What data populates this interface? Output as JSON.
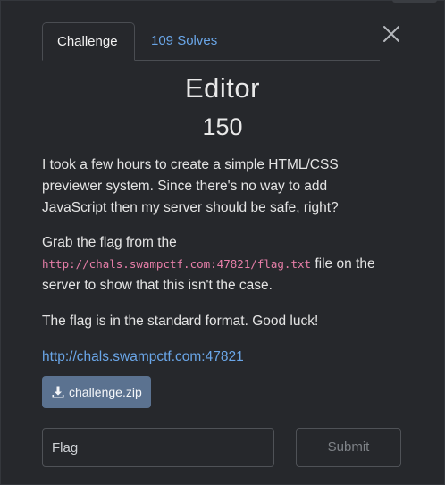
{
  "tabs": {
    "challenge": "Challenge",
    "solves": "109 Solves"
  },
  "challenge": {
    "name": "Editor",
    "points": "150",
    "description": {
      "p1": "I took a few hours to create a simple HTML/CSS previewer system. Since there's no way to add JavaScript then my server should be safe, right?",
      "p2_before": "Grab the flag from the",
      "p2_code": "http://chals.swampctf.com:47821/flag.txt",
      "p2_after": "file on the server to show that this isn't the case.",
      "p3": "The flag is in the standard format. Good luck!",
      "link": "http://chals.swampctf.com:47821"
    },
    "file": "challenge.zip"
  },
  "form": {
    "flag_placeholder": "Flag",
    "submit_label": "Submit"
  },
  "icons": {
    "close": "close-icon",
    "download": "download-icon"
  },
  "colors": {
    "background": "#26282c",
    "link": "#6aa6e8",
    "code": "#e67ea8",
    "button": "#5b7290"
  }
}
